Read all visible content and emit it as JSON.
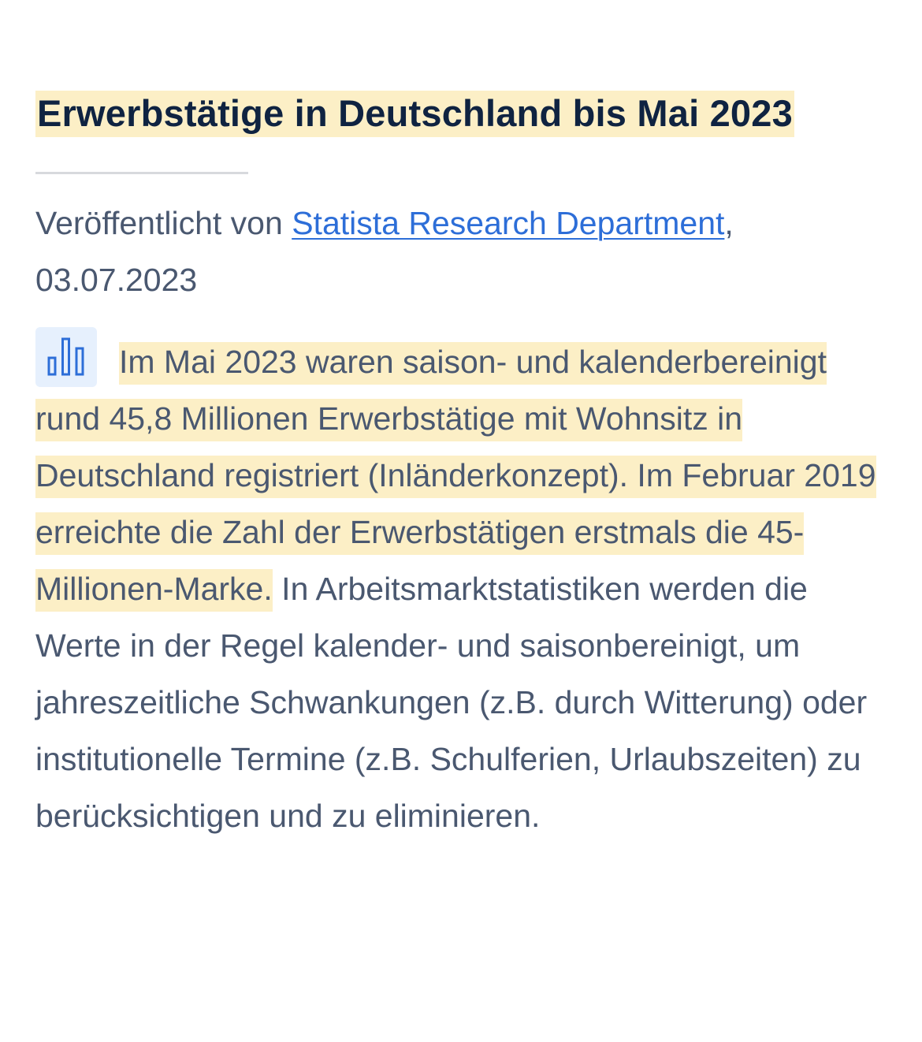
{
  "article": {
    "title": "Erwerbstätige in Deutschland bis Mai 2023",
    "published_prefix": "Veröffentlicht von",
    "author": "Statista Research Department",
    "author_suffix": ",",
    "date": "03.07.2023",
    "description_highlighted": "Im Mai 2023 waren saison- und kalenderbereinigt rund 45,8 Millionen Erwerbstätige mit Wohnsitz in Deutschland registriert (Inländerkonzept). Im Februar 2019 erreichte die Zahl der Erwerbstätigen erstmals die 45-Millionen-Marke.",
    "description_rest": "In Arbeitsmarktstatistiken werden die Werte in der Regel kalender- und saisonbereinigt, um jahreszeitliche Schwankungen (z.B. durch Witterung) oder institutionelle Termine (z.B. Schulferien, Urlaubszeiten) zu berücksichtigen und zu eliminieren."
  },
  "icons": {
    "statistic": "bar-chart-icon"
  },
  "colors": {
    "highlight": "#fcefc6",
    "title": "#0f2341",
    "text": "#4a5870",
    "link": "#2d6ed8",
    "icon": "#2d6ed8",
    "icon_background": "#e6f0fd",
    "divider": "#d7d9dd"
  }
}
